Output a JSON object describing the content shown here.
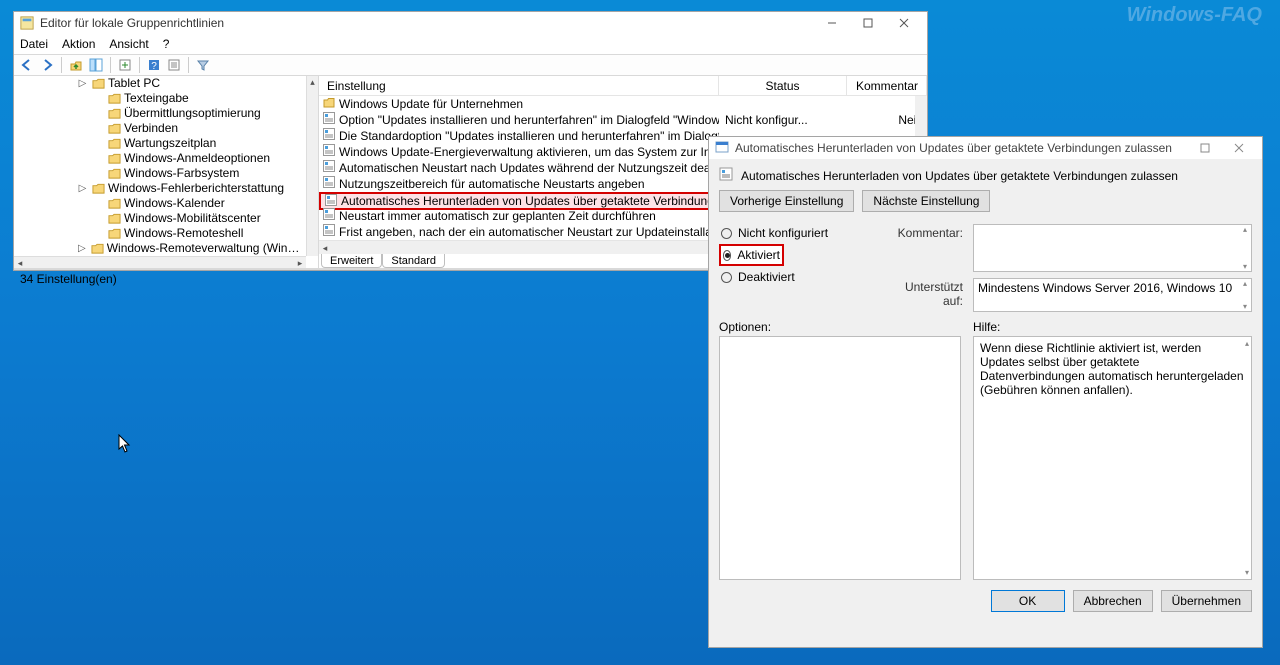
{
  "watermark": "Windows-FAQ",
  "gpedit": {
    "title": "Editor für lokale Gruppenrichtlinien",
    "menu": {
      "file": "Datei",
      "action": "Aktion",
      "view": "Ansicht",
      "help": "?"
    },
    "tree_indent_base": 64,
    "tree_nodes": [
      {
        "label": "Tablet PC",
        "indent": 64,
        "expandable": true
      },
      {
        "label": "Texteingabe",
        "indent": 80
      },
      {
        "label": "Übermittlungsoptimierung",
        "indent": 80
      },
      {
        "label": "Verbinden",
        "indent": 80
      },
      {
        "label": "Wartungszeitplan",
        "indent": 80
      },
      {
        "label": "Windows-Anmeldeoptionen",
        "indent": 80
      },
      {
        "label": "Windows-Farbsystem",
        "indent": 80
      },
      {
        "label": "Windows-Fehlerberichterstattung",
        "indent": 64,
        "expandable": true
      },
      {
        "label": "Windows-Kalender",
        "indent": 80
      },
      {
        "label": "Windows-Mobilitätscenter",
        "indent": 80
      },
      {
        "label": "Windows-Remoteshell",
        "indent": 80
      },
      {
        "label": "Windows-Remoteverwaltung (Windows Remote",
        "indent": 64,
        "expandable": true
      }
    ],
    "columns": {
      "name": "Einstellung",
      "status": "Status",
      "comment": "Kommentar"
    },
    "rows": [
      {
        "type": "folder",
        "name": "Windows Update für Unternehmen",
        "status": "",
        "comment": ""
      },
      {
        "type": "setting",
        "name": "Option \"Updates installieren und herunterfahren\" im Dialogfeld \"Windows herunterfah...",
        "status": "Nicht konfigur...",
        "comment": "Nein"
      },
      {
        "type": "setting",
        "name": "Die Standardoption \"Updates installieren und herunterfahren\" im Dialogfeld \"Windo",
        "status": "",
        "comment": ""
      },
      {
        "type": "setting",
        "name": "Windows Update-Energieverwaltung aktivieren, um das System zur Installation von g",
        "status": "",
        "comment": ""
      },
      {
        "type": "setting",
        "name": "Automatischen Neustart nach Updates während der Nutzungszeit deaktivieren",
        "status": "",
        "comment": ""
      },
      {
        "type": "setting",
        "name": "Nutzungszeitbereich für automatische Neustarts angeben",
        "status": "",
        "comment": ""
      },
      {
        "type": "setting",
        "name": "Automatisches Herunterladen von Updates über getaktete Verbindungen zulassen",
        "status": "",
        "comment": "",
        "highlight": true
      },
      {
        "type": "setting",
        "name": "Neustart immer automatisch zur geplanten Zeit durchführen",
        "status": "",
        "comment": ""
      },
      {
        "type": "setting",
        "name": "Frist angeben, nach der ein automatischer Neustart zur Updateinstallation ausgeführ",
        "status": "",
        "comment": ""
      }
    ],
    "tabs": {
      "extended": "Erweitert",
      "standard": "Standard"
    },
    "statusbar": "34 Einstellung(en)"
  },
  "dialog": {
    "title": "Automatisches Herunterladen von Updates über getaktete Verbindungen zulassen",
    "heading": "Automatisches Herunterladen von Updates über getaktete Verbindungen zulassen",
    "prev": "Vorherige Einstellung",
    "next": "Nächste Einstellung",
    "radio_notconfigured": "Nicht konfiguriert",
    "radio_enabled": "Aktiviert",
    "radio_disabled": "Deaktiviert",
    "comment_label": "Kommentar:",
    "supported_label": "Unterstützt auf:",
    "supported_text": "Mindestens Windows Server 2016, Windows 10",
    "options_label": "Optionen:",
    "help_label": "Hilfe:",
    "help_text": "Wenn diese Richtlinie aktiviert ist, werden Updates selbst über getaktete Datenverbindungen automatisch heruntergeladen (Gebühren können anfallen).",
    "ok": "OK",
    "cancel": "Abbrechen",
    "apply": "Übernehmen"
  }
}
